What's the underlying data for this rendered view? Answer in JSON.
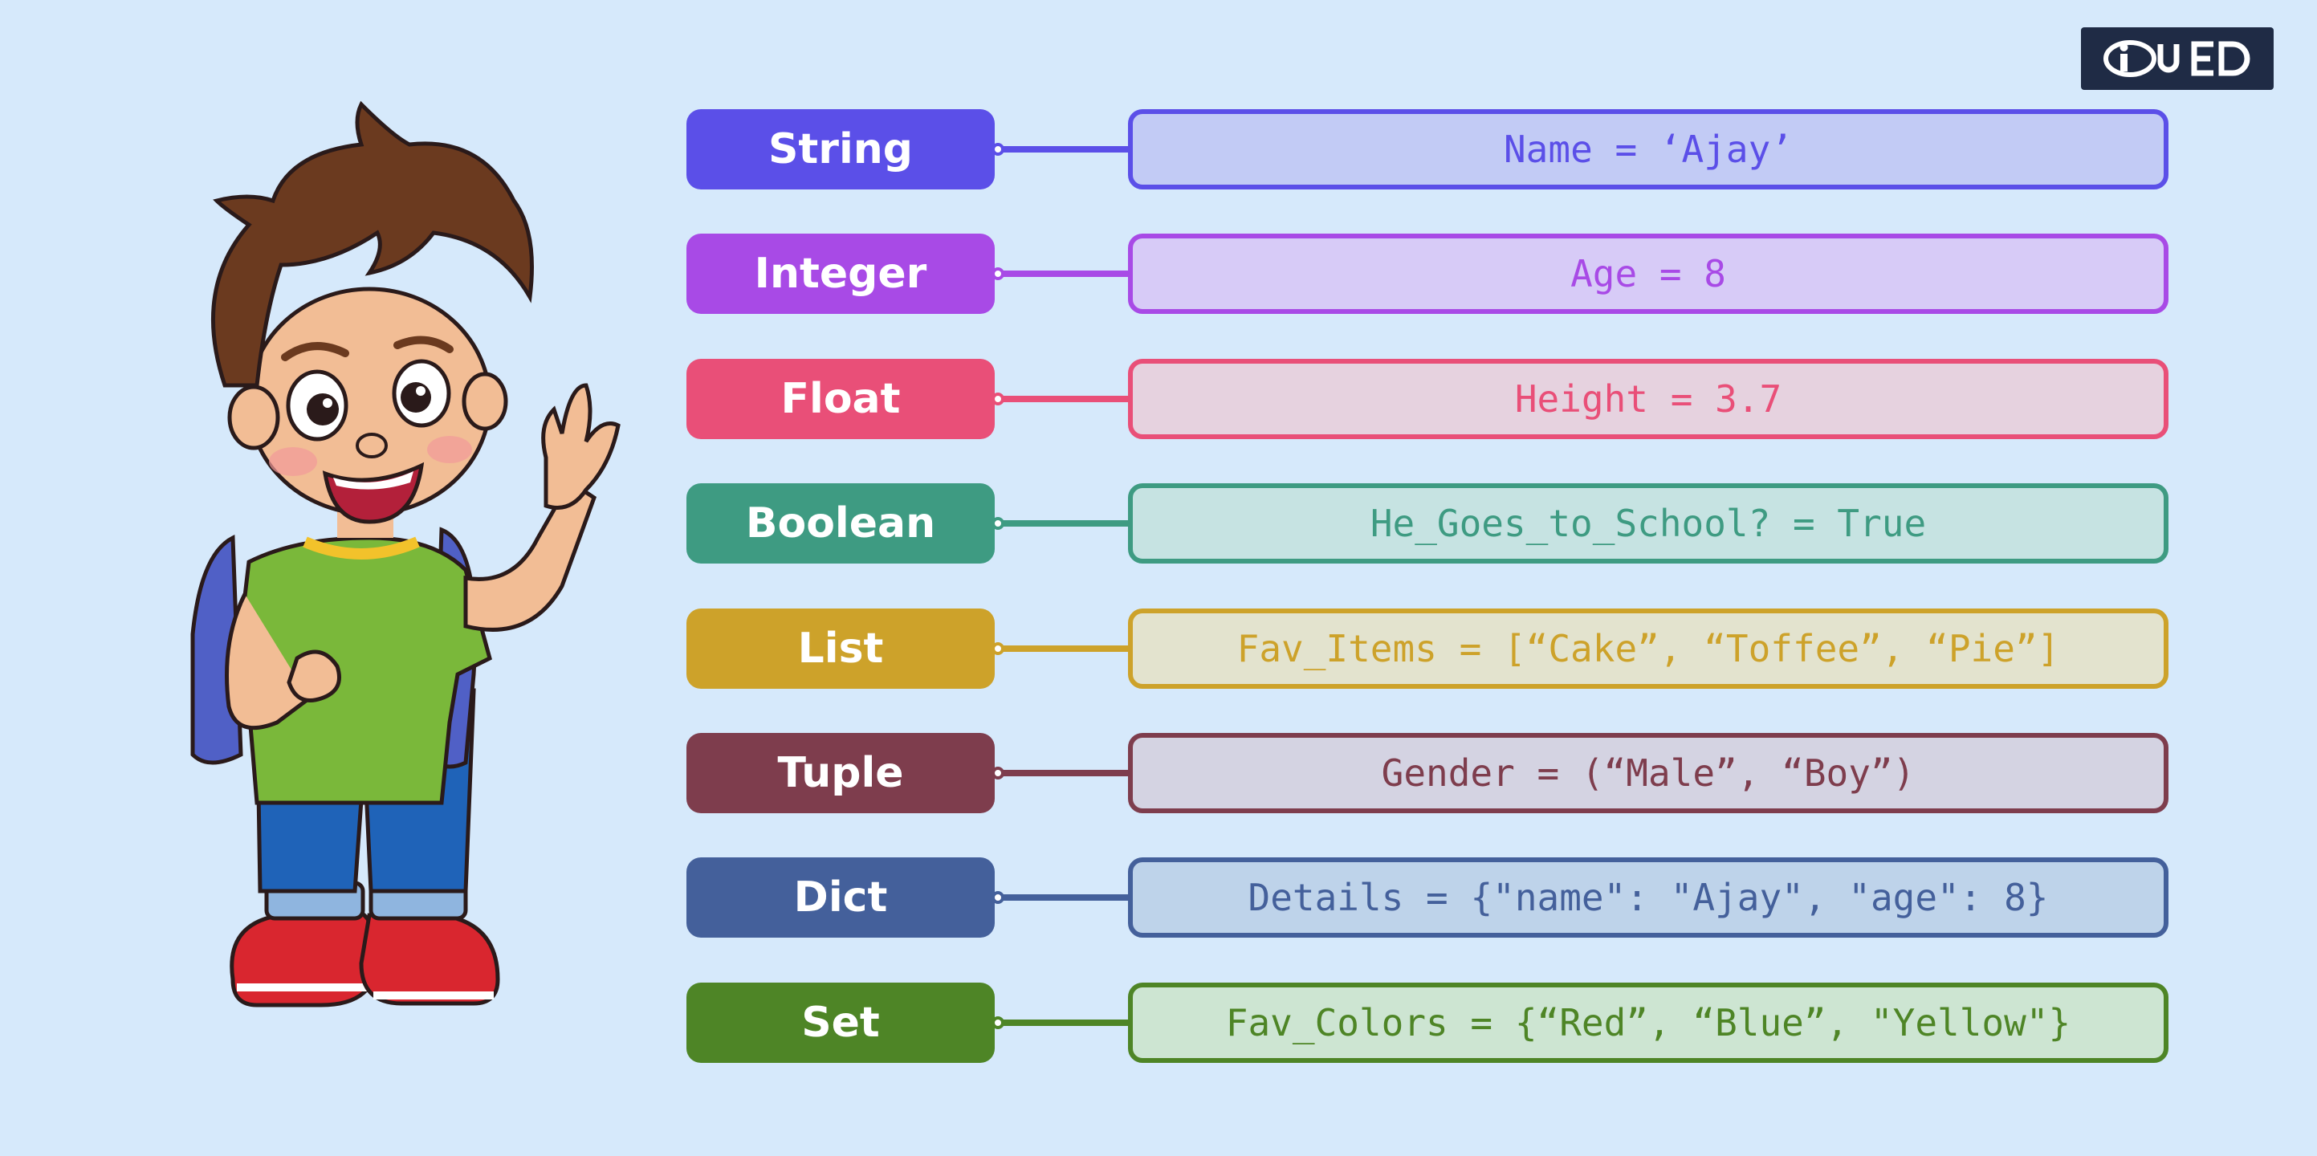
{
  "logo": {
    "text": "IQUED"
  },
  "rows": [
    {
      "type": "String",
      "value": "Name = ‘Ajay’",
      "color": "#5b4fe8",
      "fill": "#c2cbf5"
    },
    {
      "type": "Integer",
      "value": "Age = 8",
      "color": "#a84ae6",
      "fill": "#d7cbf7"
    },
    {
      "type": "Float",
      "value": "Height = 3.7",
      "color": "#e94f78",
      "fill": "#e6d2df"
    },
    {
      "type": "Boolean",
      "value": "He_Goes_to_School? = True",
      "color": "#3e9b82",
      "fill": "#c6e3e2"
    },
    {
      "type": "List",
      "value": "Fav_Items = [“Cake”, “Toffee”, “Pie”]",
      "color": "#cda22a",
      "fill": "#e3e3ce"
    },
    {
      "type": "Tuple",
      "value": "Gender = (“Male”, “Boy”)",
      "color": "#7e3d4d",
      "fill": "#d4d3e2"
    },
    {
      "type": "Dict",
      "value": "Details = {\"name\": \"Ajay\", \"age\": 8}",
      "color": "#44609b",
      "fill": "#bed3ea"
    },
    {
      "type": "Set",
      "value": "Fav_Colors = {“Red”, “Blue”, \"Yellow\"}",
      "color": "#4e8526",
      "fill": "#cde5d2"
    }
  ]
}
